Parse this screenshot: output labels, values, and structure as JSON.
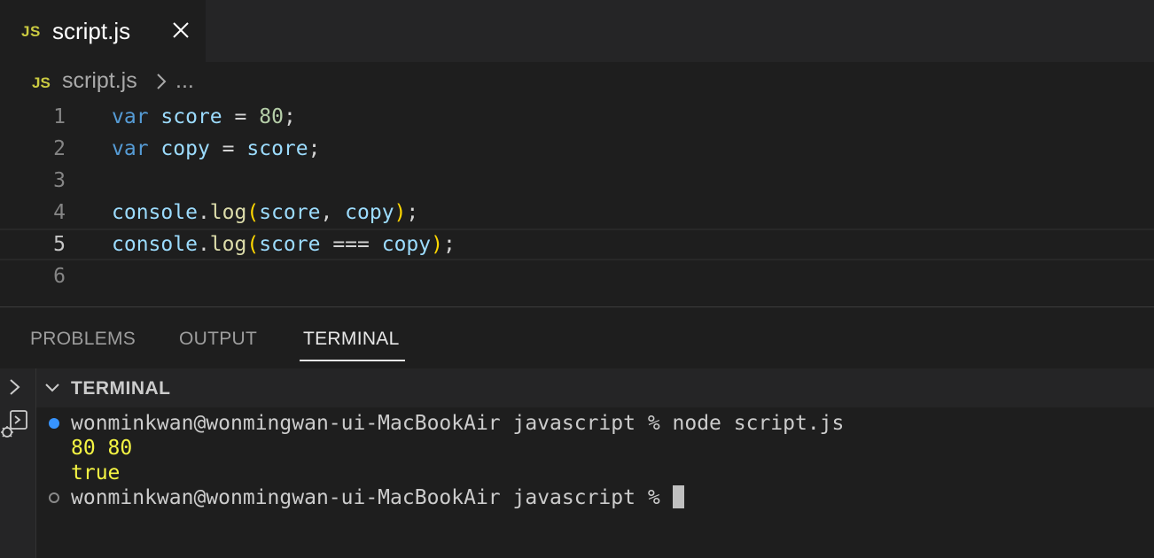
{
  "tab": {
    "icon": "JS",
    "label": "script.js",
    "close_icon": "close-icon"
  },
  "breadcrumb": {
    "icon": "JS",
    "file": "script.js",
    "more": "..."
  },
  "editor": {
    "lines": [
      {
        "num": "1",
        "text": "var score = 80;"
      },
      {
        "num": "2",
        "text": "var copy = score;"
      },
      {
        "num": "3",
        "text": ""
      },
      {
        "num": "4",
        "text": "console.log(score, copy);"
      },
      {
        "num": "5",
        "text": "console.log(score === copy);"
      },
      {
        "num": "6",
        "text": ""
      }
    ],
    "current_line": "5"
  },
  "panel": {
    "tabs": [
      "PROBLEMS",
      "OUTPUT",
      "TERMINAL"
    ],
    "active_tab": "TERMINAL"
  },
  "terminal": {
    "title": "TERMINAL",
    "lines": [
      {
        "type": "prompt",
        "text": "wonminkwan@wonmingwan-ui-MacBookAir javascript % node script.js"
      },
      {
        "type": "output",
        "text": "80 80"
      },
      {
        "type": "output",
        "text": "true"
      },
      {
        "type": "prompt",
        "text": "wonminkwan@wonmingwan-ui-MacBookAir javascript % "
      }
    ]
  },
  "colors": {
    "keyword": "#569cd6",
    "variable": "#9cdcfe",
    "number": "#b5cea8",
    "function": "#dcdcaa",
    "bracket": "#ffd700",
    "terminal_output": "#f5f543",
    "success_dot": "#3794ff"
  }
}
